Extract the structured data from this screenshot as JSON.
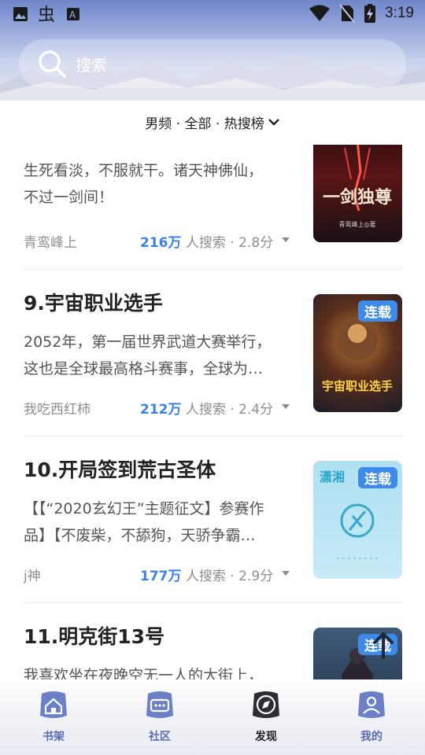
{
  "status_bar": {
    "time": "3:19",
    "left_icons": [
      "image-icon",
      "bug-icon",
      "font-a-icon"
    ],
    "right_icons": [
      "wifi-icon",
      "no-sim-icon",
      "battery-charging-icon"
    ]
  },
  "search": {
    "placeholder": "搜索",
    "icon": "search-icon"
  },
  "filter": {
    "label": "男频 · 全部 · 热搜榜",
    "icon": "chevron-down-icon"
  },
  "books": [
    {
      "title": "",
      "desc_lines": [
        "生死看淡，不服就干。诸天神佛仙，",
        "不过一剑间！"
      ],
      "author": "青鸾峰上",
      "count": "216万",
      "stats_suffix": " 人搜索 · 2.8分",
      "badge": "",
      "cover_title": "一剑独尊",
      "cover_author": "青鸾峰上◎著"
    },
    {
      "title": "9.宇宙职业选手",
      "desc_lines": [
        "2052年，第一届世界武道大赛举行，",
        "这也是全球最高格斗赛事，全球为…"
      ],
      "author": "我吃西红柿",
      "count": "212万",
      "stats_suffix": " 人搜索 · 2.4分",
      "badge": "连载",
      "cover_title": "宇宙职业选手"
    },
    {
      "title": "10.开局签到荒古圣体",
      "desc_lines": [
        "【【“2020玄幻王”主题征文】参赛作",
        "品】【不废柴，不舔狗，天骄争霸…"
      ],
      "author": "j神",
      "count": "177万",
      "stats_suffix": " 人搜索 · 2.9分",
      "badge": "连载",
      "cover_title": "潇湘"
    },
    {
      "title": "11.明克街13号",
      "desc_lines": [
        "我喜欢坐在夜晚空无一人的大街上，"
      ],
      "author": "",
      "count": "",
      "stats_suffix": "",
      "badge": "连载",
      "cover_title": ""
    }
  ],
  "bottom_nav": [
    {
      "label": "书架",
      "icon": "bookshelf-house-icon",
      "active": false
    },
    {
      "label": "社区",
      "icon": "community-chat-icon",
      "active": false
    },
    {
      "label": "发现",
      "icon": "compass-icon",
      "active": true
    },
    {
      "label": "我的",
      "icon": "profile-icon",
      "active": false
    }
  ],
  "colors": {
    "accent": "#3c82e6",
    "badge": "#3d8ae8",
    "nav_inactive": "#5a6bb0"
  }
}
